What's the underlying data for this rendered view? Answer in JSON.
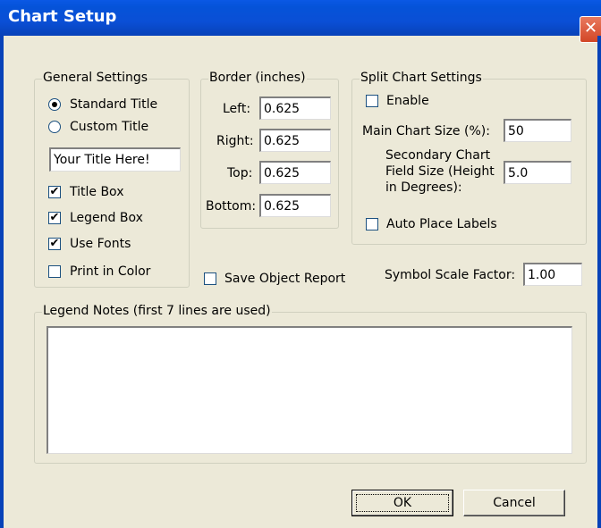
{
  "window": {
    "title": "Chart Setup",
    "close_label": "✕"
  },
  "general": {
    "legend": "General Settings",
    "title_mode": "standard",
    "standard_title_label": "Standard Title",
    "custom_title_label": "Custom Title",
    "title_value": "Your Title Here!",
    "title_box_label": "Title Box",
    "title_box_checked": true,
    "legend_box_label": "Legend Box",
    "legend_box_checked": true,
    "use_fonts_label": "Use Fonts",
    "use_fonts_checked": true,
    "print_color_label": "Print in Color",
    "print_color_checked": false
  },
  "border": {
    "legend": "Border (inches)",
    "left_label": "Left:",
    "left_value": "0.625",
    "right_label": "Right:",
    "right_value": "0.625",
    "top_label": "Top:",
    "top_value": "0.625",
    "bottom_label": "Bottom:",
    "bottom_value": "0.625"
  },
  "split": {
    "legend": "Split Chart Settings",
    "enable_label": "Enable",
    "enable_checked": false,
    "main_size_label": "Main Chart Size (%):",
    "main_size_value": "50",
    "secondary_label_line1": "Secondary Chart",
    "secondary_label_line2": "Field Size (Height",
    "secondary_label_line3": "in Degrees):",
    "secondary_value": "5.0",
    "auto_place_label": "Auto Place Labels",
    "auto_place_checked": false
  },
  "save_report": {
    "label": "Save Object Report",
    "checked": false
  },
  "symbol_scale": {
    "label": "Symbol Scale Factor:",
    "value": "1.00"
  },
  "legend_notes": {
    "legend": "Legend Notes (first 7 lines are used)",
    "value": ""
  },
  "buttons": {
    "ok": "OK",
    "cancel": "Cancel"
  },
  "check_glyph": "✔"
}
